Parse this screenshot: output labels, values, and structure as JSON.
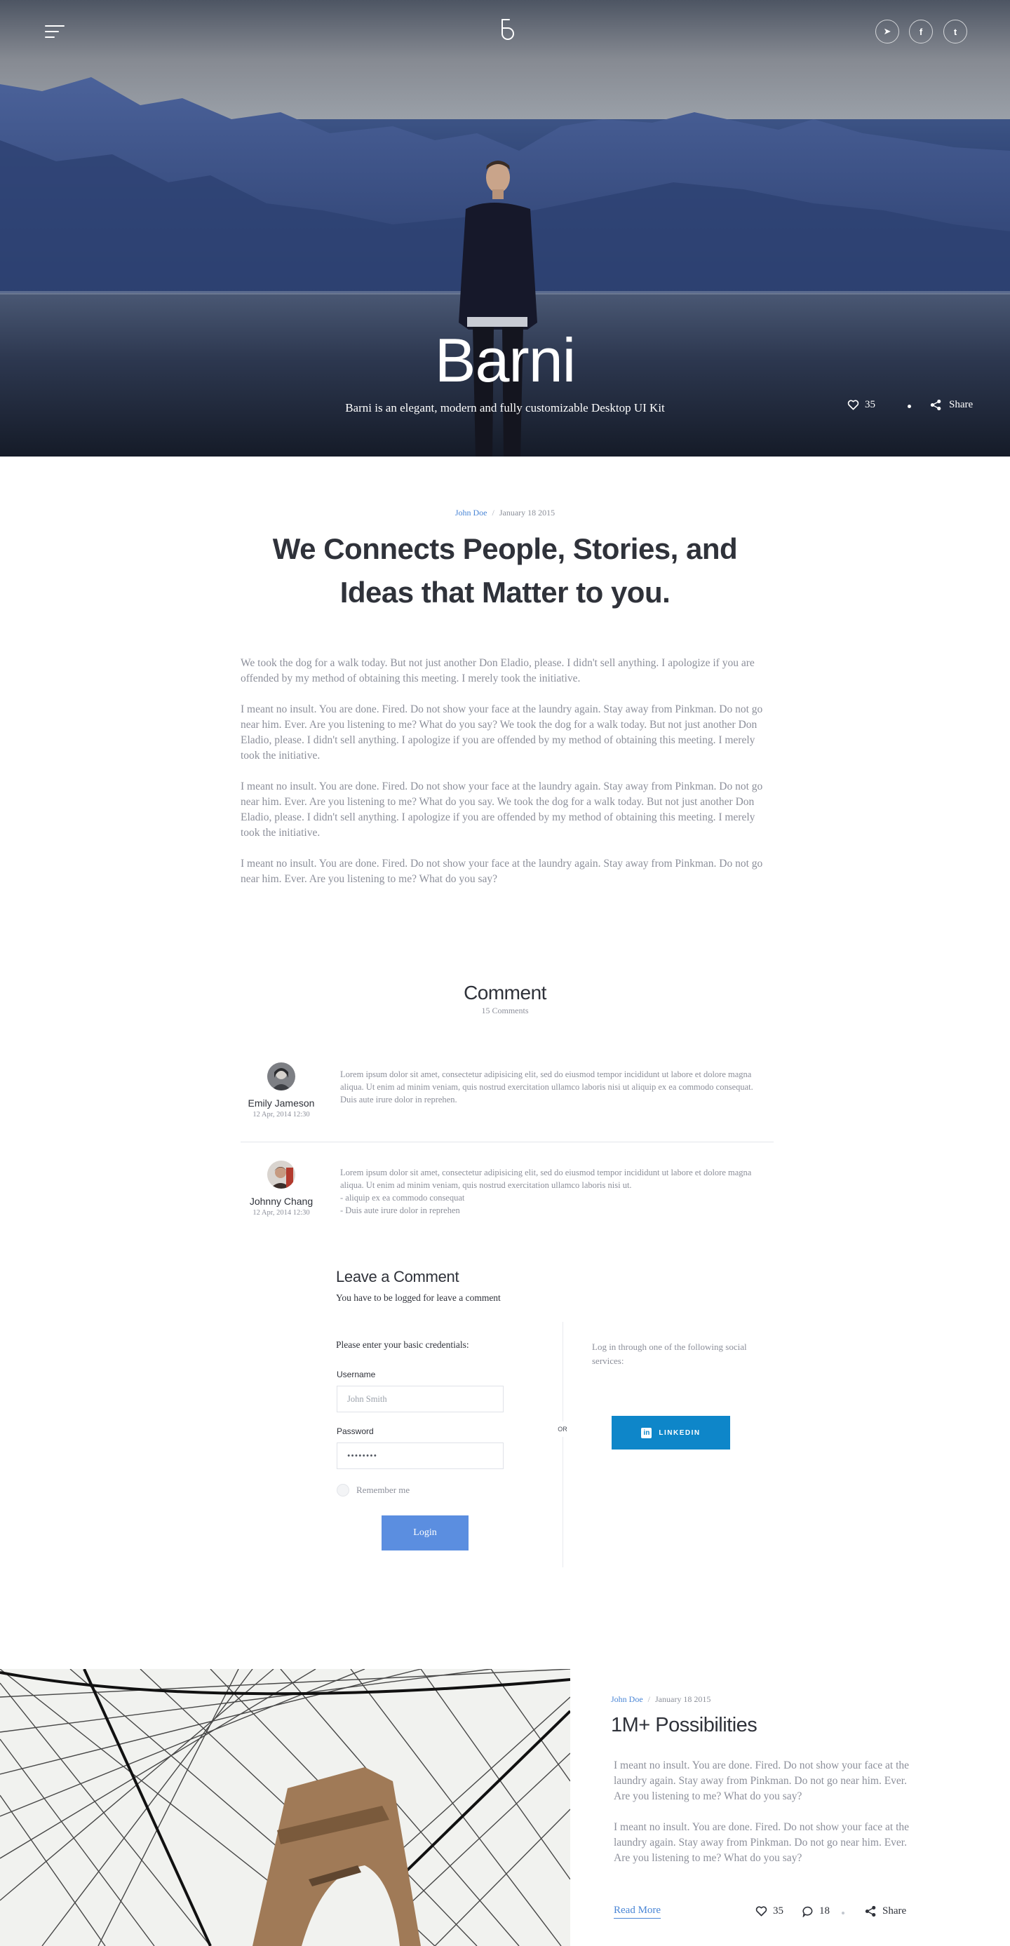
{
  "hero": {
    "title": "Barni",
    "subtitle": "Barni is an elegant, modern and fully customizable Desktop UI Kit",
    "likes": "35",
    "share_label": "Share",
    "icons": [
      "menu-icon",
      "logo-icon",
      "send-icon",
      "facebook-icon",
      "twitter-icon",
      "heart-icon",
      "share-icon"
    ],
    "social": [
      {
        "name": "send",
        "glyph": "➤"
      },
      {
        "name": "facebook",
        "glyph": "f"
      },
      {
        "name": "twitter",
        "glyph": "t"
      }
    ]
  },
  "article": {
    "author": "John Doe",
    "date": "January 18 2015",
    "title_line1": "We Connects People, Stories, and",
    "title_line2": "Ideas that Matter to you.",
    "paragraphs": [
      "We took the dog for a walk today. But not just another Don Eladio, please. I didn't sell anything. I apologize if you are offended by my method of obtaining this meeting. I merely took the initiative.",
      "I meant no insult. You are done. Fired. Do not show your face at the laundry again. Stay away from Pinkman. Do not go near him. Ever. Are you listening to me? What do you say? We took the dog for a walk today. But not just another Don Eladio, please. I didn't sell anything. I apologize if you are offended by my method of obtaining this meeting. I merely took the initiative.",
      "I meant no insult. You are done. Fired. Do not show your face at the laundry again. Stay away from Pinkman. Do not go near him. Ever. Are you listening to me? What do you say. We took the dog for a walk today. But not just another Don Eladio, please. I didn't sell anything. I apologize if you are offended by my method of obtaining this meeting. I merely took the initiative.",
      "I meant no insult. You are done. Fired. Do not show your face at the laundry again. Stay away from Pinkman. Do not go near him. Ever. Are you listening to me? What do you say?"
    ]
  },
  "comments": {
    "heading": "Comment",
    "count": "15 Comments",
    "items": [
      {
        "author": "Emily Jameson",
        "date": "12 Apr, 2014 12:30",
        "text": "Lorem ipsum dolor sit amet, consectetur adipisicing elit, sed do eiusmod tempor incididunt ut labore et dolore magna aliqua. Ut enim ad minim veniam, quis nostrud exercitation ullamco laboris nisi ut aliquip ex ea commodo consequat. Duis aute irure dolor in reprehen."
      },
      {
        "author": "Johnny Chang",
        "date": "12 Apr, 2014 12:30",
        "text": "Lorem ipsum dolor sit amet, consectetur adipisicing elit, sed do eiusmod tempor incididunt ut labore et dolore magna aliqua. Ut enim ad minim veniam, quis nostrud exercitation ullamco laboris nisi ut.",
        "bullets": [
          "- aliquip ex ea commodo consequat",
          "- Duis aute irure dolor in reprehen"
        ]
      }
    ]
  },
  "leave_comment": {
    "title": "Leave a Comment",
    "subtitle": "You have to be logged for leave a comment",
    "credentials_label": "Please enter your basic credentials:",
    "username_label": "Username",
    "username_placeholder": "John Smith",
    "password_label": "Password",
    "password_value": "••••••••",
    "remember_label": "Remember me",
    "login_label": "Login",
    "or_label": "OR",
    "social_text": "Log in through one of the following social services:",
    "linkedin_label": "LINKEDIN",
    "linkedin_mark": "in"
  },
  "card": {
    "author": "John Doe",
    "date": "January 18 2015",
    "title": "1M+ Possibilities",
    "paragraphs": [
      "I meant no insult. You are done. Fired. Do not show your face at the laundry again. Stay away from Pinkman. Do not go near him. Ever. Are you listening to me? What do you say?",
      "I meant no insult. You are done. Fired. Do not show your face at the laundry again. Stay away from Pinkman. Do not go near him. Ever. Are you listening to me? What do you say?"
    ],
    "read_more": "Read More",
    "likes": "35",
    "comments": "18",
    "share_label": "Share"
  },
  "colors": {
    "accent": "#5b8ee0",
    "link": "#4a86d6",
    "linkedin": "#0e86c9",
    "text_dark": "#2f323a",
    "text_muted": "#8c8f9a"
  }
}
